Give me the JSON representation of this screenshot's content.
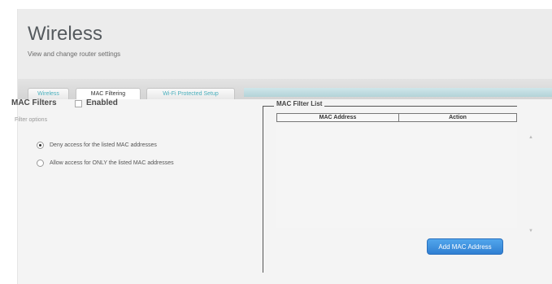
{
  "header": {
    "title": "Wireless",
    "subtitle": "View and change router settings"
  },
  "tabs": [
    {
      "label": "Wireless",
      "active": false
    },
    {
      "label": "MAC Filtering",
      "active": true
    },
    {
      "label": "Wi-Fi Protected Setup",
      "active": false
    }
  ],
  "mac_filters": {
    "label": "MAC Filters",
    "enabled_label": "Enabled",
    "enabled_checked": false,
    "filter_options_label": "Filter options",
    "options": [
      {
        "label": "Deny access for the listed MAC addresses",
        "selected": true
      },
      {
        "label": "Allow access for ONLY the listed MAC addresses",
        "selected": false
      }
    ]
  },
  "mac_filter_list": {
    "legend": "MAC Filter List",
    "columns": [
      "MAC Address",
      "Action"
    ],
    "rows": [],
    "add_button_label": "Add MAC Address"
  },
  "colors": {
    "accent_tab_text": "#4ab0bd",
    "button_blue": "#3f93e0"
  }
}
